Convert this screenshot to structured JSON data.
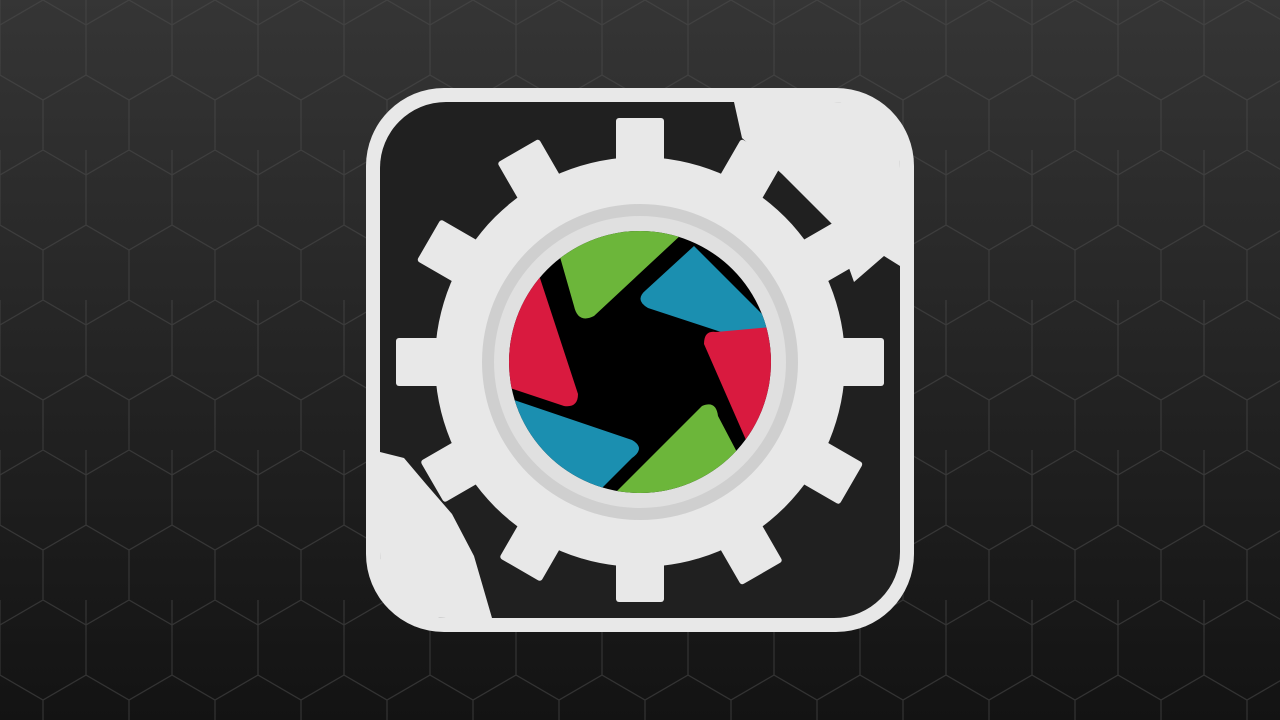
{
  "scene": {
    "background": {
      "pattern": "hexagon-grid",
      "colors": {
        "top": "#353535",
        "bottom": "#141414",
        "hex_stroke": "#4a4a4a"
      }
    },
    "logo": {
      "icon": "gear-camera-aperture-icon",
      "colors": {
        "frame": "#e9e9e9",
        "gear": "#e9e9e9",
        "gear_inner_ring": "#cfcfcf",
        "frame_inner": "#222222",
        "aperture_center": "#000000",
        "blade_green": "#6cb63a",
        "blade_blue": "#1b8fb0",
        "blade_red": "#d91a3f"
      }
    }
  }
}
